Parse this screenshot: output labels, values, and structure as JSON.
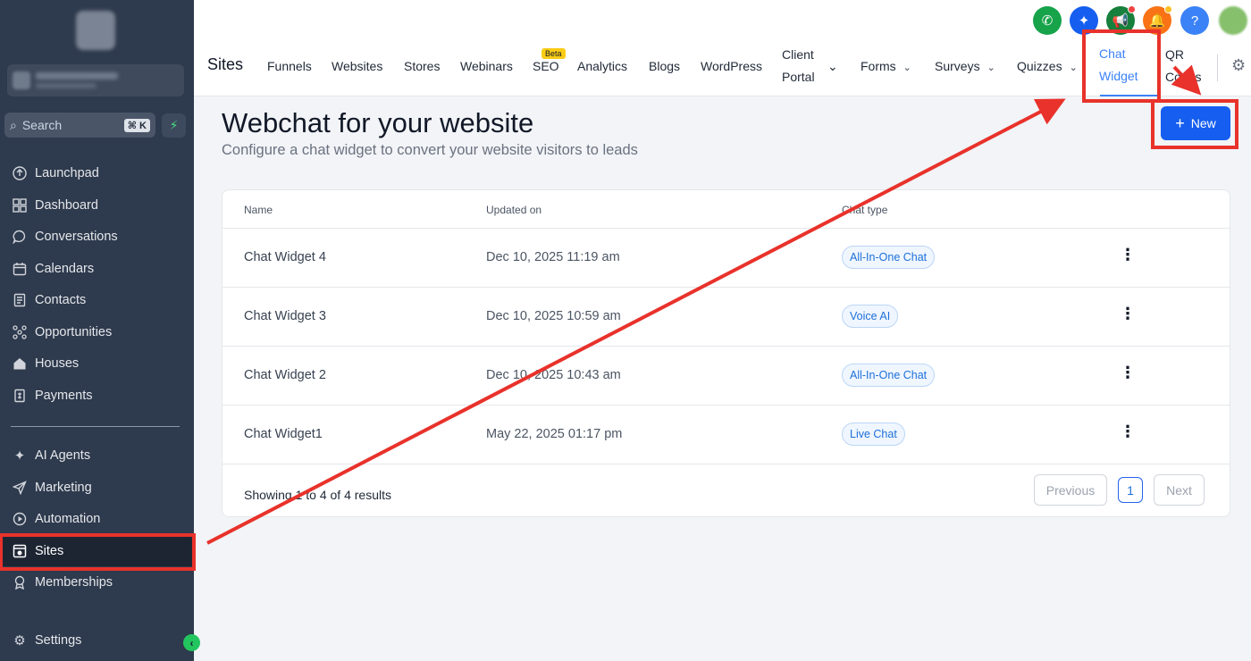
{
  "sidebar": {
    "search_placeholder": "Search",
    "search_shortcut": "⌘ K",
    "items": [
      {
        "label": "Launchpad",
        "icon": "rocket-icon"
      },
      {
        "label": "Dashboard",
        "icon": "dashboard-icon"
      },
      {
        "label": "Conversations",
        "icon": "chat-bubble-icon"
      },
      {
        "label": "Calendars",
        "icon": "calendar-icon"
      },
      {
        "label": "Contacts",
        "icon": "contacts-icon"
      },
      {
        "label": "Opportunities",
        "icon": "opportunities-icon"
      },
      {
        "label": "Houses",
        "icon": "house-icon"
      },
      {
        "label": "Payments",
        "icon": "payments-icon"
      }
    ],
    "items2": [
      {
        "label": "AI Agents",
        "icon": "sparkle-icon"
      },
      {
        "label": "Marketing",
        "icon": "send-icon"
      },
      {
        "label": "Automation",
        "icon": "automation-icon"
      },
      {
        "label": "Sites",
        "icon": "sites-icon",
        "active": true
      },
      {
        "label": "Memberships",
        "icon": "award-icon"
      }
    ],
    "settings_label": "Settings"
  },
  "header": {
    "section_title": "Sites",
    "tabs": [
      {
        "label": "Funnels"
      },
      {
        "label": "Websites"
      },
      {
        "label": "Stores"
      },
      {
        "label": "Webinars"
      },
      {
        "label": "SEO",
        "badge": "Beta"
      },
      {
        "label": "Analytics"
      },
      {
        "label": "Blogs"
      },
      {
        "label": "WordPress"
      },
      {
        "label": "Client Portal",
        "line1": "Client",
        "line2": "Portal",
        "dropdown": true
      },
      {
        "label": "Forms",
        "dropdown": true
      },
      {
        "label": "Surveys",
        "dropdown": true
      },
      {
        "label": "Quizzes",
        "dropdown": true
      },
      {
        "label": "Chat Widget",
        "line1": "Chat",
        "line2": "Widget",
        "active": true
      },
      {
        "label": "QR Codes",
        "line1": "QR",
        "line2": "Codes"
      }
    ],
    "top_icons": [
      {
        "name": "phone-icon",
        "color": "#15803d"
      },
      {
        "name": "ai-sparkle-icon",
        "color": "#155eef"
      },
      {
        "name": "megaphone-icon",
        "color": "#16803c"
      },
      {
        "name": "bell-icon",
        "color": "#f97316"
      },
      {
        "name": "help-icon",
        "color": "#3b82f6"
      }
    ]
  },
  "main": {
    "title": "Webchat for your website",
    "subtitle": "Configure a chat widget to convert your website visitors to leads",
    "new_button": "New",
    "columns": [
      "Name",
      "Updated on",
      "Chat type"
    ],
    "rows": [
      {
        "name": "Chat Widget 4",
        "updated": "Dec 10, 2025 11:19 am",
        "type": "All-In-One Chat"
      },
      {
        "name": "Chat Widget 3",
        "updated": "Dec 10, 2025 10:59 am",
        "type": "Voice AI"
      },
      {
        "name": "Chat Widget 2",
        "updated": "Dec 10, 2025 10:43 am",
        "type": "All-In-One Chat"
      },
      {
        "name": "Chat Widget1",
        "updated": "May 22, 2025 01:17 pm",
        "type": "Live Chat"
      }
    ],
    "showing": "Showing 1 to 4 of 4 results",
    "prev": "Previous",
    "page": "1",
    "next": "Next"
  },
  "colors": {
    "sidebar_bg": "#2e3a4d",
    "accent": "#155eef",
    "annotation": "#e8322b"
  }
}
